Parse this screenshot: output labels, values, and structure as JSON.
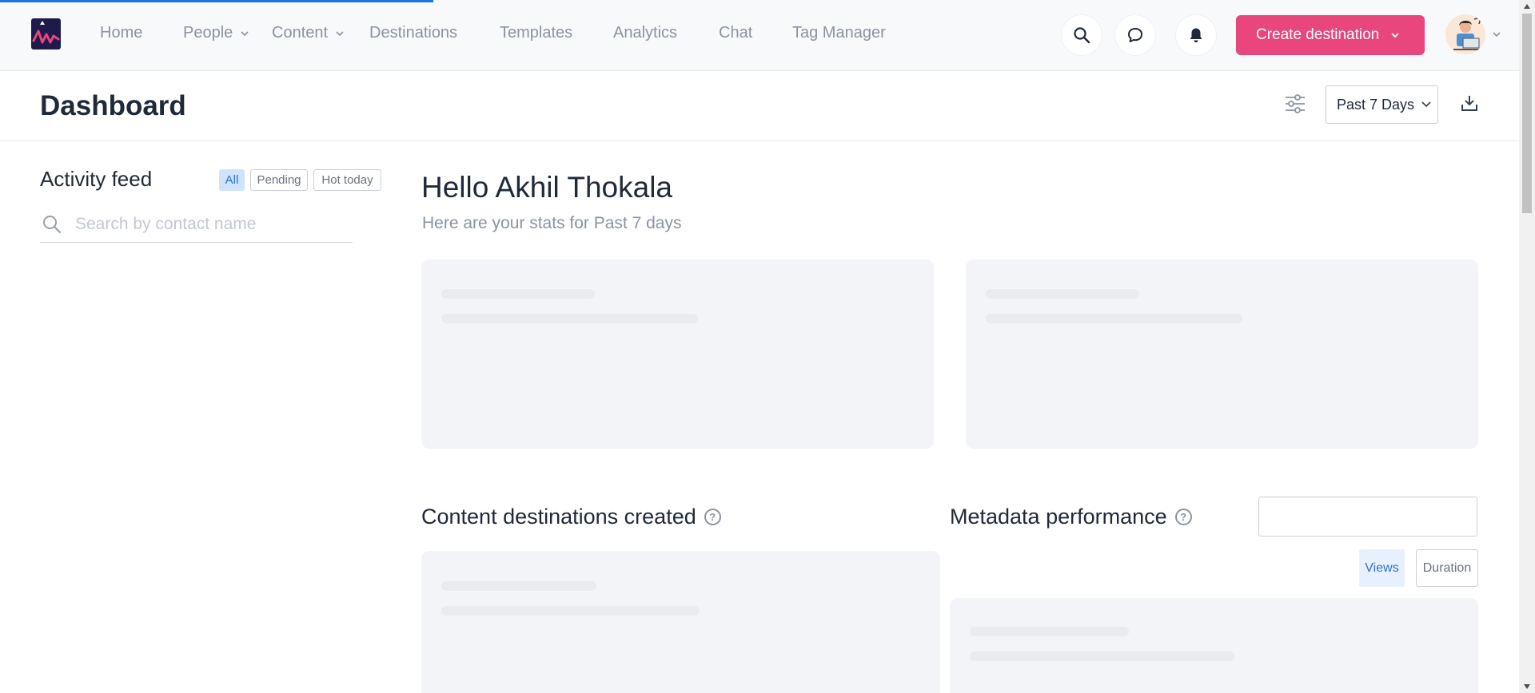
{
  "nav": {
    "items": [
      {
        "label": "Home"
      },
      {
        "label": "People"
      },
      {
        "label": "Content"
      },
      {
        "label": "Destinations"
      },
      {
        "label": "Templates"
      },
      {
        "label": "Analytics"
      },
      {
        "label": "Chat"
      },
      {
        "label": "Tag Manager"
      }
    ],
    "create_label": "Create destination",
    "colors": {
      "accent": "#e8467c",
      "logo_bg": "#1e1b4b",
      "progress": "#1a73e8"
    }
  },
  "header": {
    "title": "Dashboard",
    "period": "Past 7 Days"
  },
  "activity_feed": {
    "title": "Activity feed",
    "filters": [
      "All",
      "Pending",
      "Hot today"
    ],
    "search_placeholder": "Search by contact name"
  },
  "main": {
    "greeting": "Hello Akhil Thokala",
    "subgreeting": "Here are your stats for Past 7 days",
    "sections": {
      "destinations_title": "Content destinations created",
      "metadata_title": "Metadata performance",
      "toggle_views": "Views",
      "toggle_duration": "Duration"
    }
  },
  "icons": {
    "search": "search-icon",
    "chat": "chat-bubble-icon",
    "notifications": "bell-icon",
    "filter": "sliders-icon",
    "download": "download-icon",
    "help": "help-circle-icon"
  }
}
